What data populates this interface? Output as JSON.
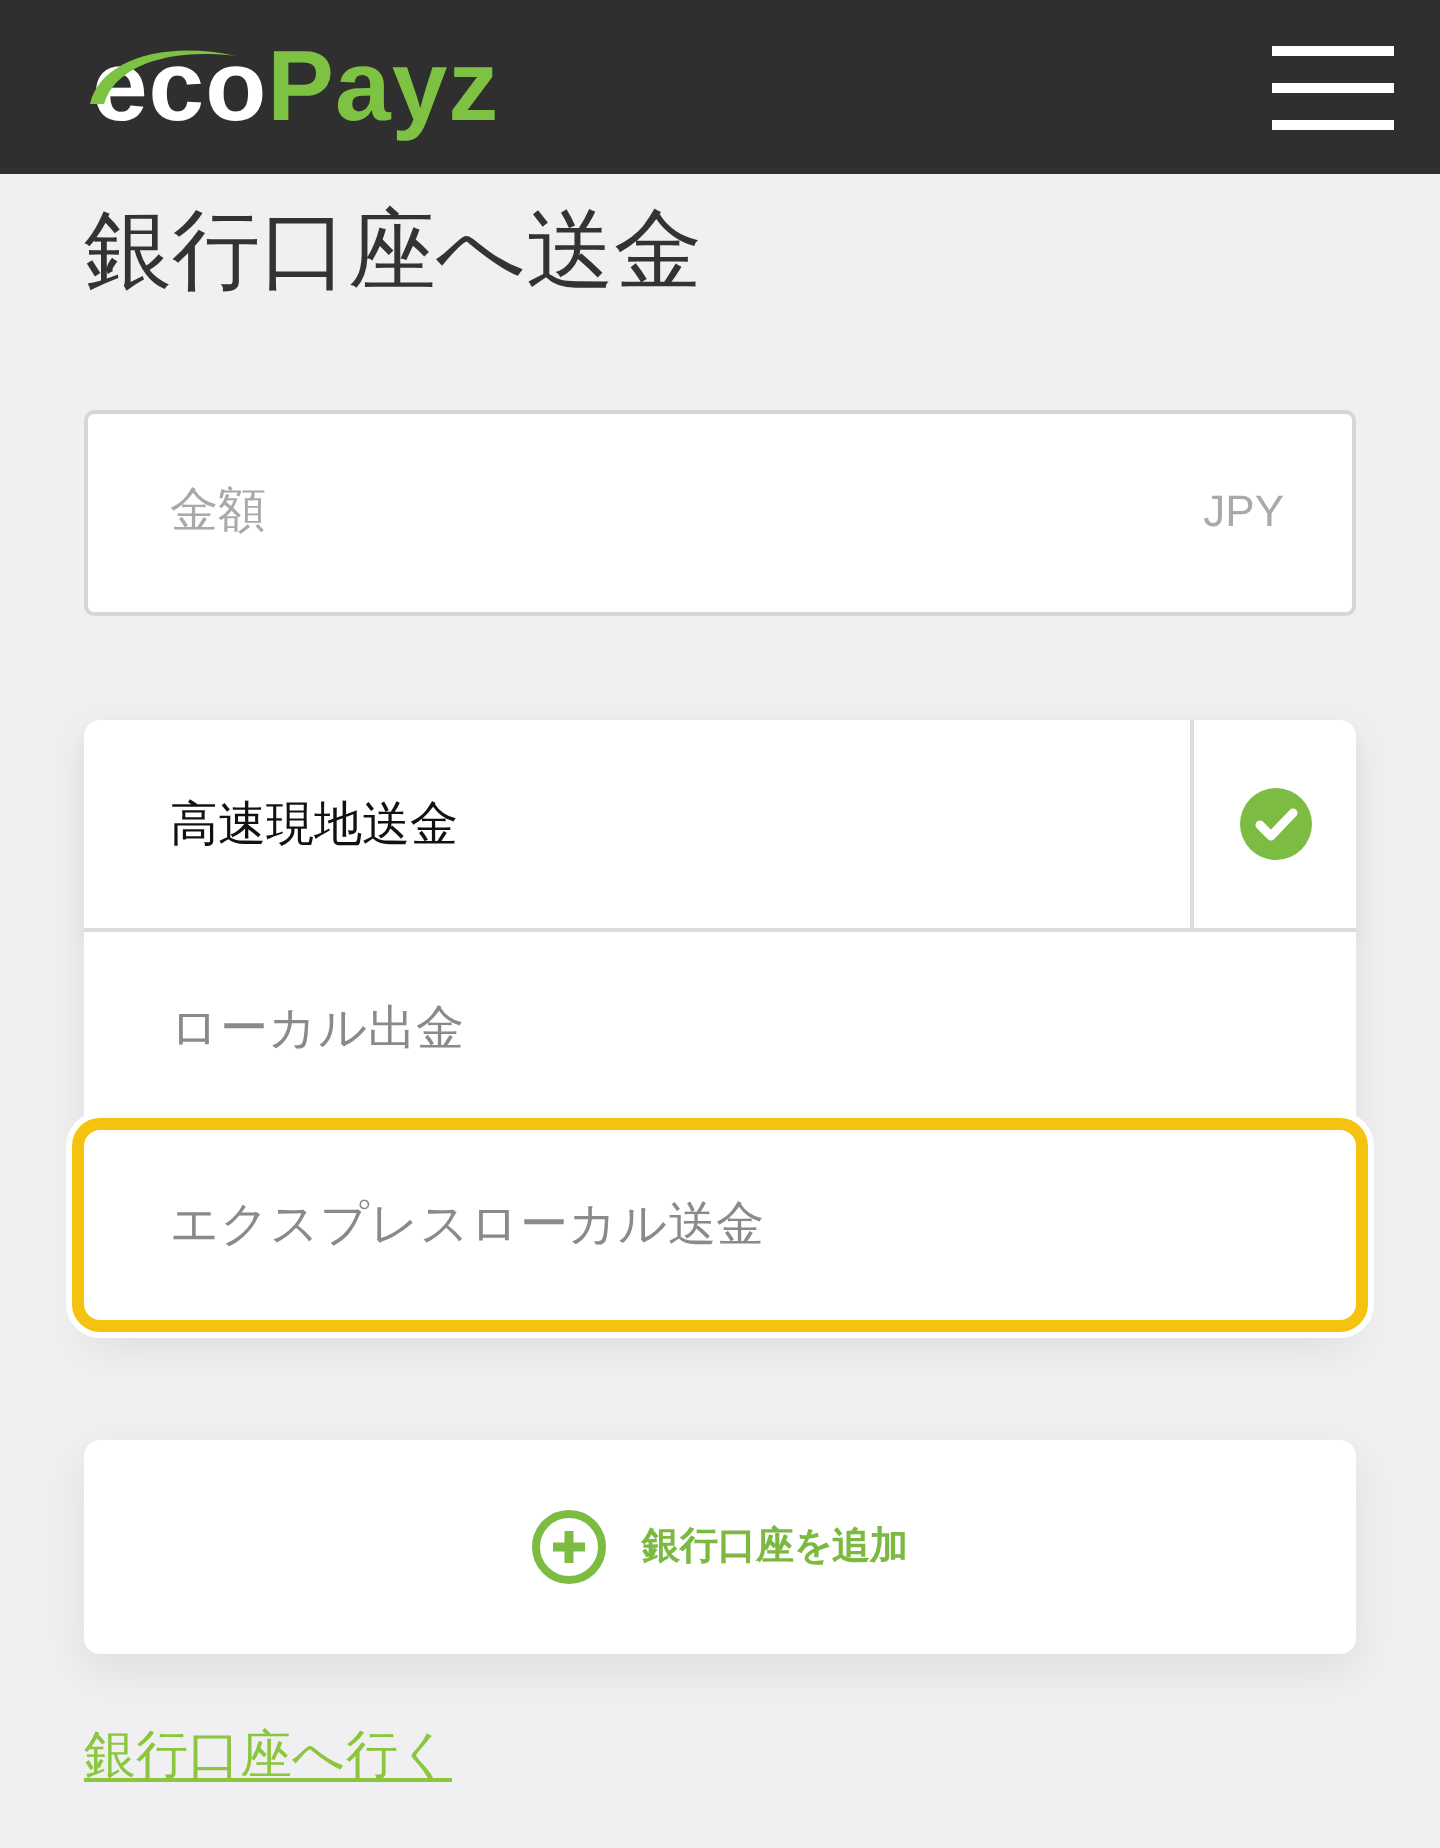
{
  "header": {
    "logo": {
      "part_1": "eco",
      "part_2": "Payz"
    }
  },
  "page": {
    "title": "銀行口座へ送金"
  },
  "amount_field": {
    "placeholder": "金額",
    "currency": "JPY"
  },
  "transfer_options": [
    {
      "label": "高速現地送金",
      "selected": true,
      "focused": false
    },
    {
      "label": "ローカル出金",
      "selected": false,
      "focused": false
    },
    {
      "label": "エクスプレスローカル送金",
      "selected": false,
      "focused": true
    }
  ],
  "add_bank_button": {
    "label": "銀行口座を追加"
  },
  "bank_accounts_link": {
    "label": "銀行口座へ行く"
  }
}
